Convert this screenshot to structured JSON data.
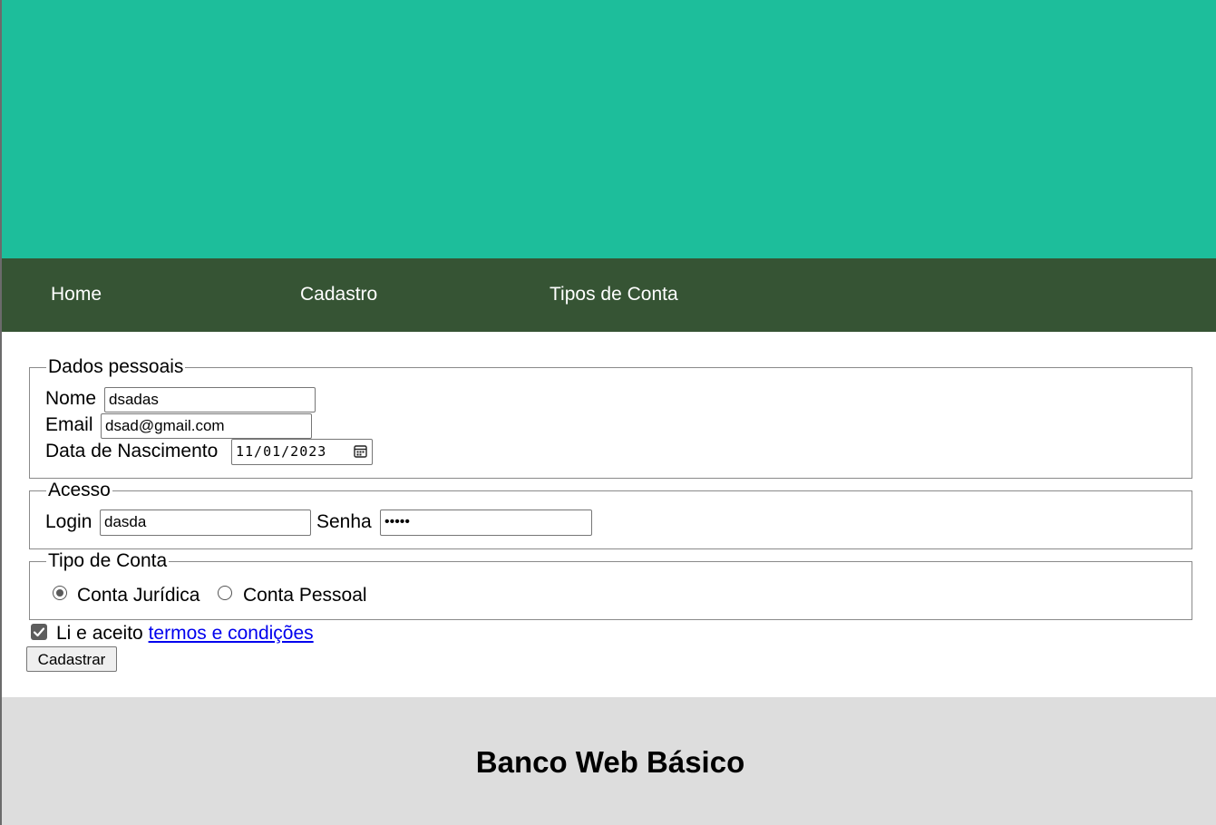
{
  "nav": {
    "items": [
      {
        "label": "Home"
      },
      {
        "label": "Cadastro"
      },
      {
        "label": "Tipos de Conta"
      }
    ]
  },
  "form": {
    "personal": {
      "legend": "Dados pessoais",
      "name_label": "Nome",
      "name_value": "dsadas",
      "email_label": "Email",
      "email_value": "dsad@gmail.com",
      "birth_label": "Data de Nascimento",
      "birth_value": "11/01/2023"
    },
    "access": {
      "legend": "Acesso",
      "login_label": "Login",
      "login_value": "dasda",
      "password_label": "Senha",
      "password_value": "•••••"
    },
    "account_type": {
      "legend": "Tipo de Conta",
      "options": [
        {
          "label": "Conta Jurídica",
          "checked": true
        },
        {
          "label": "Conta Pessoal",
          "checked": false
        }
      ]
    },
    "terms": {
      "prefix": "Li e aceito",
      "link": "termos e condições",
      "checked": true
    },
    "submit_label": "Cadastrar"
  },
  "footer": {
    "title": "Banco Web Básico"
  },
  "colors": {
    "hero": "#1dbe9b",
    "navbar": "#365434",
    "footer": "#dddddd",
    "link": "#0000ee"
  }
}
